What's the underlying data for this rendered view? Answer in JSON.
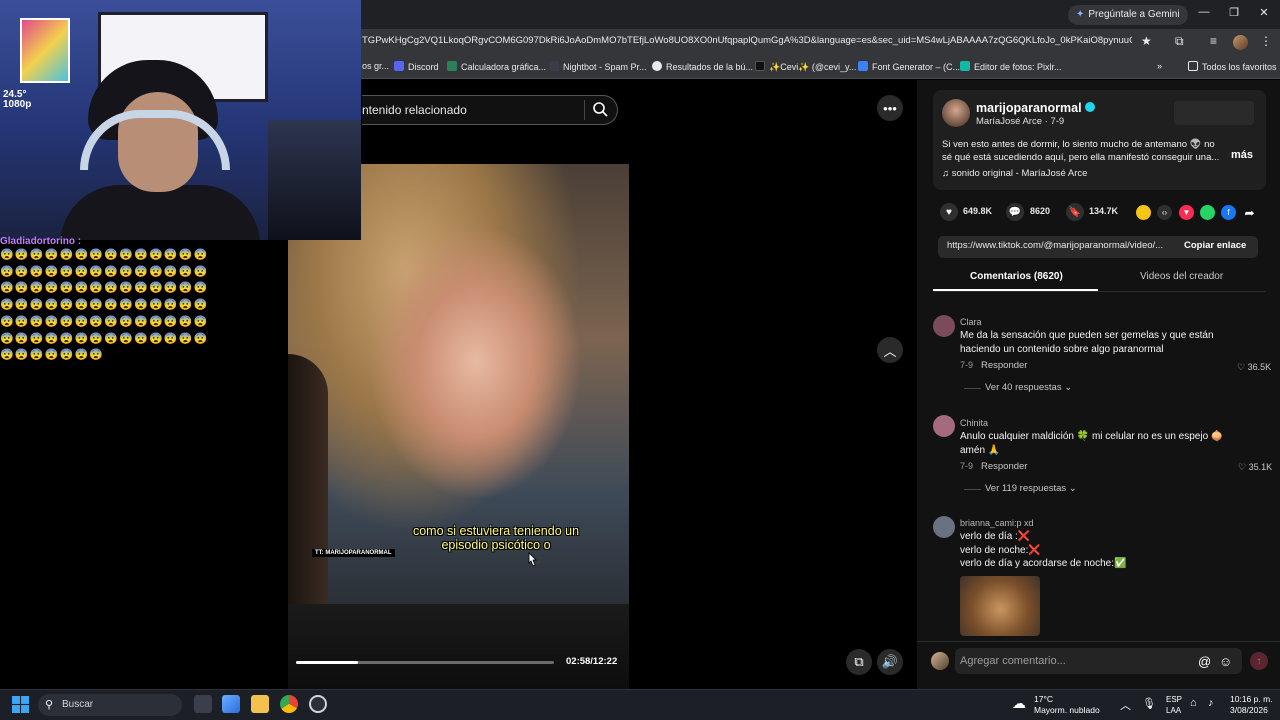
{
  "browser": {
    "gemini_label": "Pregúntale a Gemini",
    "url": "TGPwKHgCg2VQ1LkoqORgvCOM6G097DkRi6JoAoDmMO7bTEfjLoWo8UO8XO0nUfqpaplQumGgA%3D&language=es&sec_uid=MS4wLjABAAAA7zQG6QKLfoJo_0kPKaiO8pynuuOPZpVP...",
    "bookmarks": [
      {
        "label": "os gr...",
        "color": "#555a66"
      },
      {
        "label": "Discord",
        "color": "#5865f2"
      },
      {
        "label": "Calculadora gráfica...",
        "color": "#2d7f5c"
      },
      {
        "label": "Nightbot - Spam Pr...",
        "color": "#3a3d47"
      },
      {
        "label": "Resultados de la bú...",
        "color": "#e8eaed"
      },
      {
        "label": "✨Cevi✨ (@cevi_y...",
        "color": "#111111"
      },
      {
        "label": "Font Generator – (C...",
        "color": "#3b82f6"
      },
      {
        "label": "Editor de fotos: Pixlr...",
        "color": "#14b8a6"
      }
    ],
    "all_bookmarks": "Todos los favoritos"
  },
  "search": {
    "placeholder": "ntenido relacionado"
  },
  "video": {
    "subtitle_line1": "como si estuviera teniendo un",
    "subtitle_line2": "episodio psicótico o",
    "watermark": "TT: MARIJOPARANORMAL",
    "time": "02:58/12:22",
    "progress": 0.24
  },
  "stream_overlay": {
    "stats_line1": "24.5°",
    "stats_line2": "1080p",
    "chat_user": "Gladiadortorino :",
    "chat_emote": "😨",
    "chat_emote_count": 91
  },
  "post": {
    "handle": "marijoparanormal",
    "display_name": "MaríaJosé Arce · 7-9",
    "caption": "Si ven esto antes de dormir, lo siento mucho de antemano 👽 no sé qué está sucediendo aquí, pero ella manifestó conseguir una...",
    "more": "más",
    "sound": "sonido original - MaríaJosé Arce",
    "likes": "649.8K",
    "comments": "8620",
    "saves": "134.7K",
    "link": "https://www.tiktok.com/@marijoparanormal/video/...",
    "copy_link": "Copiar enlace"
  },
  "tabs": {
    "comments": "Comentarios (8620)",
    "creator_videos": "Videos del creador"
  },
  "comments": [
    {
      "user": "Clara",
      "text": "Me da la sensación que pueden ser gemelas y que están haciendo un contenido sobre algo paranormal",
      "date": "7-9",
      "reply": "Responder",
      "likes": "36.5K",
      "view_replies": "Ver 40 respuestas",
      "avatar_color": "#7a4b5a"
    },
    {
      "user": "Chinita",
      "text": "Anulo cualquier maldición 🍀 mi celular no es un espejo 🧅 amén 🙏",
      "date": "7-9",
      "reply": "Responder",
      "likes": "35.1K",
      "view_replies": "Ver 119 respuestas",
      "avatar_color": "#a56b7c"
    },
    {
      "user": "brianna_cami:p xd",
      "text1": "verlo de día :❌",
      "text2": "verlo de noche:❌",
      "text3": "verlo de día y acordarse de noche:✅",
      "avatar_color": "#6a7180"
    }
  ],
  "composer": {
    "placeholder": "Agregar comentario..."
  },
  "taskbar": {
    "search": "Buscar",
    "temp": "17°C",
    "weather": "Mayorm. nublado",
    "lang1": "ESP",
    "lang2": "LAA",
    "time": "10:16 p. m.",
    "date": "3/08/2026"
  }
}
